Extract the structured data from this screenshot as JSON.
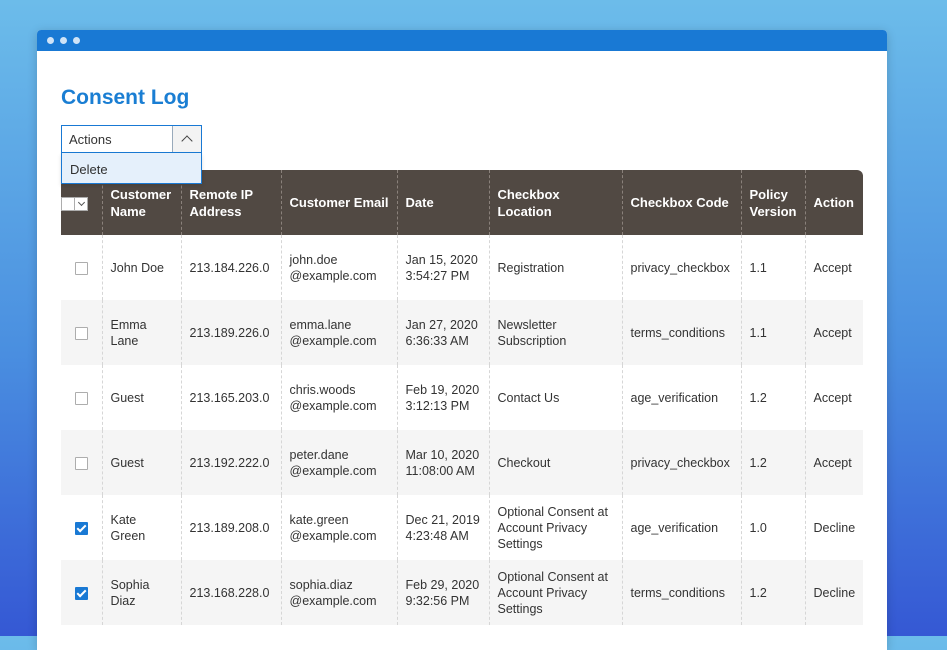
{
  "page": {
    "title": "Consent Log"
  },
  "actions": {
    "label": "Actions",
    "dropdown": [
      "Delete"
    ]
  },
  "columns": [
    "Customer Name",
    "Remote IP Address",
    "Customer Email",
    "Date",
    "Checkbox Location",
    "Checkbox Code",
    "Policy Version",
    "Action"
  ],
  "rows": [
    {
      "checked": false,
      "name": "John Doe",
      "name_link": true,
      "ip": "213.184.226.0",
      "email": "john.doe\n@example.com",
      "date": "Jan 15, 2020\n3:54:27 PM",
      "location": "Registration",
      "code": "privacy_checkbox",
      "version": "1.1",
      "action": "Accept"
    },
    {
      "checked": false,
      "name": "Emma\nLane",
      "name_link": true,
      "ip": "213.189.226.0",
      "email": "emma.lane\n@example.com",
      "date": "Jan 27, 2020\n6:36:33 AM",
      "location": "Newsletter\nSubscription",
      "code": "terms_conditions",
      "version": "1.1",
      "action": "Accept"
    },
    {
      "checked": false,
      "name": "Guest",
      "name_link": false,
      "ip": "213.165.203.0",
      "email": "chris.woods\n@example.com",
      "date": "Feb 19, 2020\n3:12:13 PM",
      "location": "Contact Us",
      "code": "age_verification",
      "version": "1.2",
      "action": "Accept"
    },
    {
      "checked": false,
      "name": "Guest",
      "name_link": false,
      "ip": "213.192.222.0",
      "email": "peter.dane\n@example.com",
      "date": "Mar 10, 2020\n11:08:00 AM",
      "location": "Checkout",
      "code": "privacy_checkbox",
      "version": "1.2",
      "action": "Accept"
    },
    {
      "checked": true,
      "name": "Kate Green",
      "name_link": true,
      "ip": "213.189.208.0",
      "email": "kate.green\n@example.com",
      "date": "Dec 21, 2019\n4:23:48 AM",
      "location": "Optional Consent at\nAccount Privacy\nSettings",
      "code": "age_verification",
      "version": "1.0",
      "action": "Decline"
    },
    {
      "checked": true,
      "name": "Sophia\nDiaz",
      "name_link": true,
      "ip": "213.168.228.0",
      "email": "sophia.diaz\n@example.com",
      "date": "Feb 29, 2020\n9:32:56 PM",
      "location": "Optional Consent at\nAccount Privacy\nSettings",
      "code": "terms_conditions",
      "version": "1.2",
      "action": "Decline"
    }
  ]
}
